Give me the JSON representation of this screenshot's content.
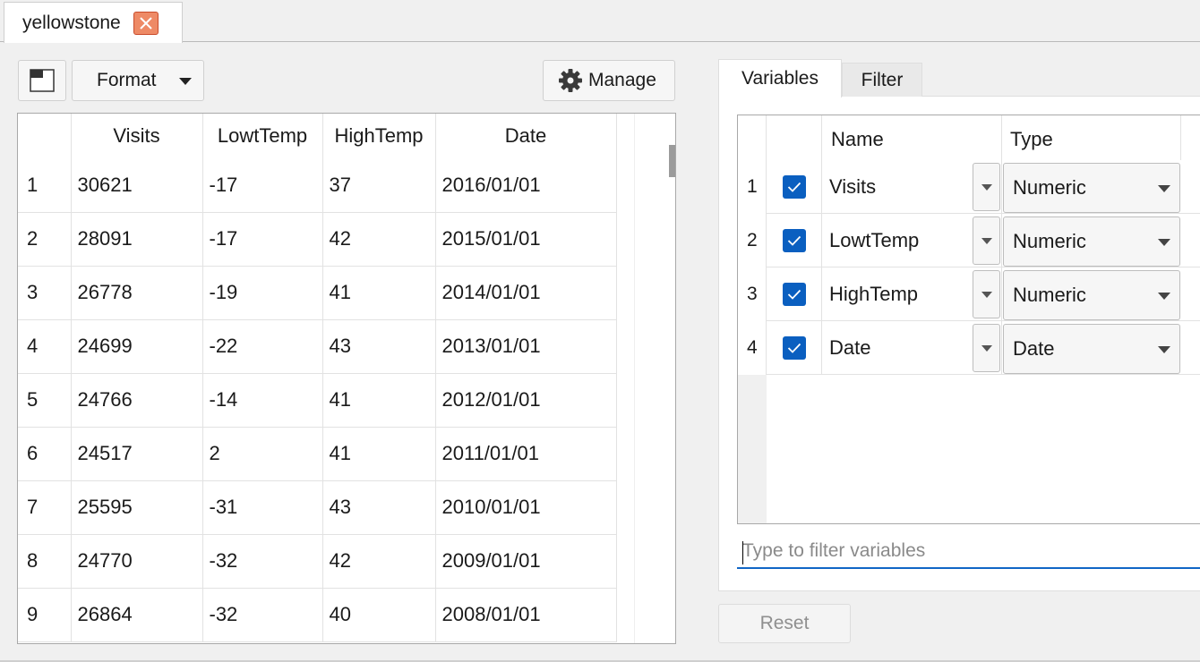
{
  "document_tab": {
    "title": "yellowstone",
    "close_icon": "close-icon"
  },
  "toolbar": {
    "layout_icon": "window-layout-icon",
    "format_label": "Format",
    "manage_label": "Manage",
    "manage_icon": "gear-icon"
  },
  "data_grid": {
    "columns": [
      "Visits",
      "LowtTemp",
      "HighTemp",
      "Date"
    ],
    "rows": [
      {
        "num": "1",
        "cells": [
          "30621",
          "-17",
          "37",
          "2016/01/01"
        ]
      },
      {
        "num": "2",
        "cells": [
          "28091",
          "-17",
          "42",
          "2015/01/01"
        ]
      },
      {
        "num": "3",
        "cells": [
          "26778",
          "-19",
          "41",
          "2014/01/01"
        ]
      },
      {
        "num": "4",
        "cells": [
          "24699",
          "-22",
          "43",
          "2013/01/01"
        ]
      },
      {
        "num": "5",
        "cells": [
          "24766",
          "-14",
          "41",
          "2012/01/01"
        ]
      },
      {
        "num": "6",
        "cells": [
          "24517",
          "2",
          "41",
          "2011/01/01"
        ]
      },
      {
        "num": "7",
        "cells": [
          "25595",
          "-31",
          "43",
          "2010/01/01"
        ]
      },
      {
        "num": "8",
        "cells": [
          "24770",
          "-32",
          "42",
          "2009/01/01"
        ]
      },
      {
        "num": "9",
        "cells": [
          "26864",
          "-32",
          "40",
          "2008/01/01"
        ]
      }
    ]
  },
  "right_panel": {
    "tabs": [
      {
        "label": "Variables",
        "active": true
      },
      {
        "label": "Filter",
        "active": false
      }
    ],
    "variables": {
      "headers": {
        "name": "Name",
        "type": "Type"
      },
      "rows": [
        {
          "num": "1",
          "checked": true,
          "name": "Visits",
          "type": "Numeric"
        },
        {
          "num": "2",
          "checked": true,
          "name": "LowtTemp",
          "type": "Numeric"
        },
        {
          "num": "3",
          "checked": true,
          "name": "HighTemp",
          "type": "Numeric"
        },
        {
          "num": "4",
          "checked": true,
          "name": "Date",
          "type": "Date"
        }
      ]
    },
    "filter_placeholder": "Type to filter variables",
    "reset_label": "Reset"
  },
  "colors": {
    "accent": "#0a5fc0",
    "close_button": "#ee8a66",
    "input_underline": "#1166c6"
  }
}
